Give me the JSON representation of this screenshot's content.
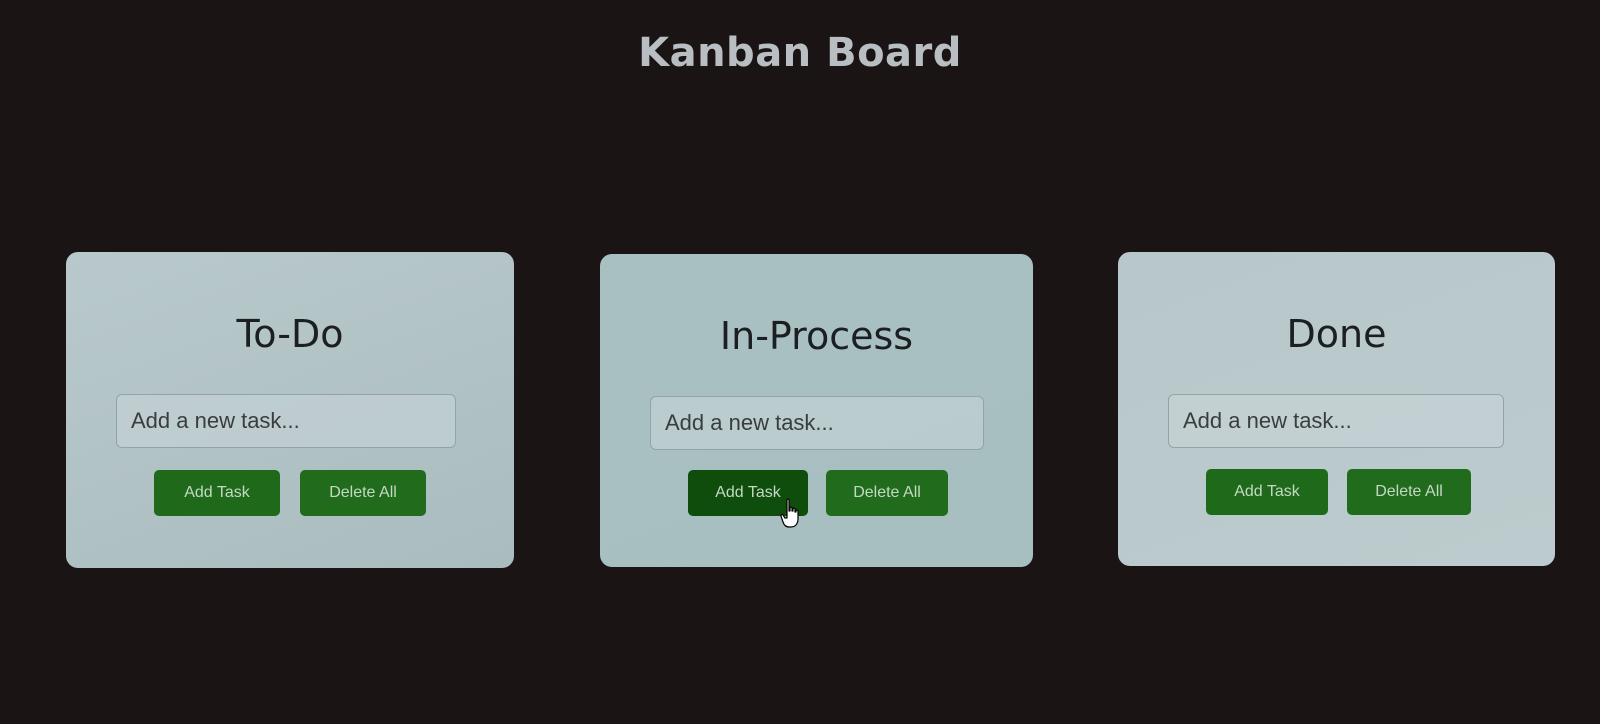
{
  "header": {
    "title": "Kanban Board"
  },
  "columns": [
    {
      "title": "To-Do",
      "input_placeholder": "Add a new task...",
      "add_label": "Add Task",
      "delete_label": "Delete All"
    },
    {
      "title": "In-Process",
      "input_placeholder": "Add a new task...",
      "add_label": "Add Task",
      "delete_label": "Delete All"
    },
    {
      "title": "Done",
      "input_placeholder": "Add a new task...",
      "add_label": "Add Task",
      "delete_label": "Delete All"
    }
  ],
  "colors": {
    "background": "#1a1514",
    "column_bg": "#b5c6c8",
    "button_green": "#1f6a1a",
    "button_green_hover": "#0f4d0d",
    "title_color": "#b8bec2"
  },
  "cursor": {
    "icon": "hand-pointer-icon"
  }
}
